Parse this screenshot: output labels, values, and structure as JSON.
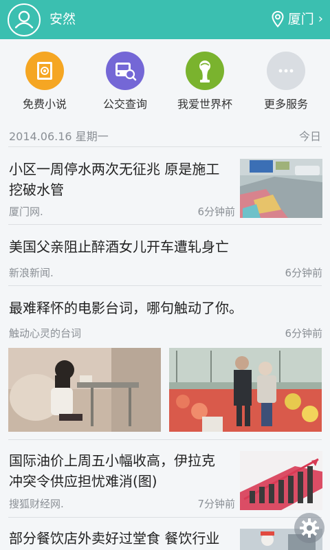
{
  "header": {
    "username": "安然",
    "city": "厦门",
    "chevron": "›",
    "color": "#3bbfb0"
  },
  "services": [
    {
      "label": "免费小说",
      "icon": "book-icon",
      "color": "#f5a623"
    },
    {
      "label": "公交查询",
      "icon": "bus-search-icon",
      "color": "#7467d6"
    },
    {
      "label": "我爱世界杯",
      "icon": "world-cup-icon",
      "color": "#7ab32e"
    },
    {
      "label": "更多服务",
      "icon": "more-dots-icon",
      "color": "#d9dde2"
    }
  ],
  "datebar": {
    "date": "2014.06.16 星期一",
    "today": "今日"
  },
  "news": [
    {
      "title_line1": "小区一周停水两次无征兆 原是施工",
      "title_line2": "挖破水管",
      "source": "厦门网.",
      "time": "6分钟前"
    },
    {
      "title": "美国父亲阻止醉酒女儿开车遭轧身亡",
      "source": "新浪新闻.",
      "time": "6分钟前"
    },
    {
      "title": "最难释怀的电影台词，哪句触动了你。",
      "source": "触动心灵的台词",
      "time": "6分钟前"
    },
    {
      "title_line1": "国际油价上周五小幅收高，伊拉克",
      "title_line2": "冲突令供应担忧难消(图)",
      "source": "搜狐财经网.",
      "time": "7分钟前"
    },
    {
      "title": "部分餐饮店外卖好过堂食 餐饮行业"
    }
  ]
}
